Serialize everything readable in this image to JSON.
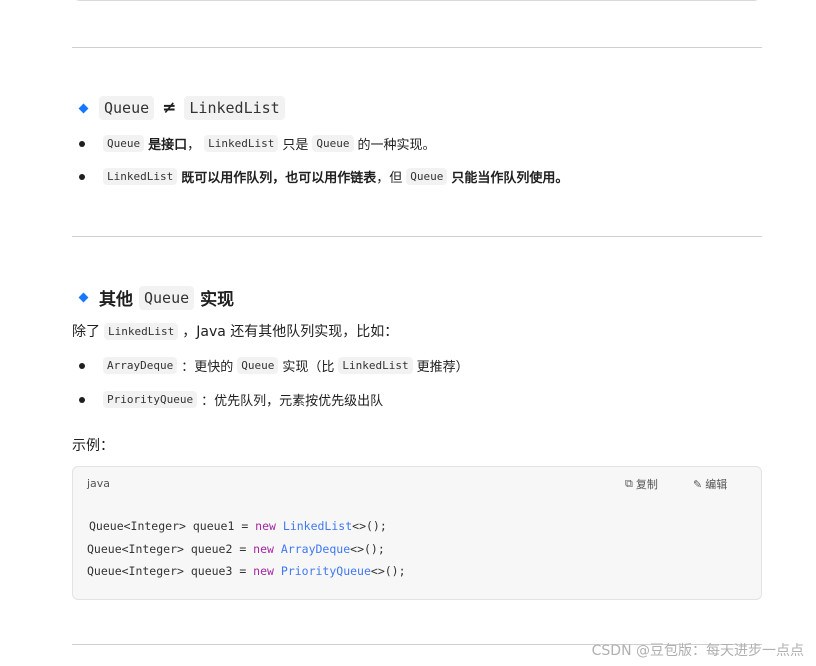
{
  "section1": {
    "heading": {
      "left_code": "Queue",
      "neq": "≠",
      "right_code": "LinkedList"
    },
    "bullets": [
      {
        "code1": "Queue",
        "bold": "是接口",
        "sep": "，",
        "code2": "LinkedList",
        "text2": "只是",
        "code3": "Queue",
        "text3": "的一种实现。"
      },
      {
        "code1": "LinkedList",
        "bold": "既可以用作队列，也可以用作链表",
        "text2": "，但",
        "code2": "Queue",
        "bold2": "只能当作队列使用。"
      }
    ]
  },
  "section2": {
    "heading": {
      "prefix": "其他",
      "code": "Queue",
      "suffix": "实现"
    },
    "intro": {
      "before": "除了",
      "code": "LinkedList",
      "after": "，Java 还有其他队列实现，比如："
    },
    "bullets": [
      {
        "code": "ArrayDeque",
        "text1": "：更快的",
        "code2": "Queue",
        "text2": "实现（比",
        "code3": "LinkedList",
        "text3": "更推荐）"
      },
      {
        "code": "PriorityQueue",
        "text1": "：优先队列，元素按优先级出队"
      }
    ],
    "example_label": "示例："
  },
  "codeblock": {
    "language": "java",
    "copy_label": "复制",
    "edit_label": "编辑",
    "lines": [
      {
        "pre": "Queue<Integer> queue1 = ",
        "kw": "new",
        "ty": "LinkedList",
        "post": "<>();"
      },
      {
        "pre": "Queue<Integer> queue2 = ",
        "kw": "new",
        "ty": "ArrayDeque",
        "post": "<>();"
      },
      {
        "pre": "Queue<Integer> queue3 = ",
        "kw": "new",
        "ty": "PriorityQueue",
        "post": "<>();"
      }
    ]
  },
  "watermark": "CSDN @豆包版：每天进步一点点",
  "colors": {
    "accent": "#1677ff",
    "keyword": "#a626a4",
    "type": "#4078f2"
  }
}
